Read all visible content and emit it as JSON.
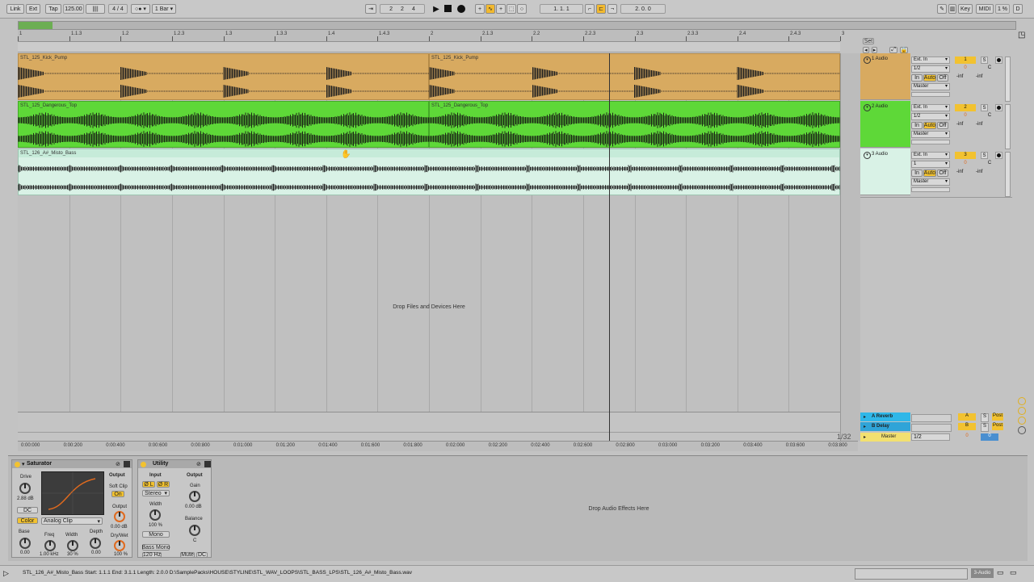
{
  "toolbar": {
    "link": "Link",
    "ext": "Ext",
    "tap": "Tap",
    "tempo": "125.00",
    "sig_num": "4",
    "sig_slash": "/",
    "sig_den": "4",
    "quant": "1 Bar",
    "pos_bar": "2",
    "pos_beat": "2",
    "pos_six": "4",
    "loop_start": "1.  1.  1",
    "loop_len": "2.   0.   0",
    "key": "Key",
    "midi": "MIDI",
    "cpu": "1 %",
    "d": "D"
  },
  "ruler": {
    "set_label": "Set",
    "bars": [
      "1",
      "1.1.3",
      "1.2",
      "1.2.3",
      "1.3",
      "1.3.3",
      "1.4",
      "1.4.3",
      "2",
      "2.1.3",
      "2.2",
      "2.2.3",
      "2.3",
      "2.3.3",
      "2.4",
      "2.4.3",
      "3"
    ]
  },
  "tracks": [
    {
      "name": "1 Audio",
      "clip1": "STL_125_Kick_Pump",
      "clip2": "STL_125_Kick_Pump",
      "input": "Ext. In",
      "channel": "1/2",
      "monitor_in": "In",
      "monitor_auto": "Auto",
      "monitor_off": "Off",
      "output": "Master",
      "num": "1",
      "vol": "0",
      "pan": "C",
      "solo": "S",
      "vol_db": "-inf",
      "peak_db": "-inf",
      "color": "#d8aa60"
    },
    {
      "name": "2 Audio",
      "clip1": "STL_125_Dangerous_Top",
      "clip2": "STL_125_Dangerous_Top",
      "input": "Ext. In",
      "channel": "1/2",
      "monitor_in": "In",
      "monitor_auto": "Auto",
      "monitor_off": "Off",
      "output": "Master",
      "num": "2",
      "vol": "0",
      "pan": "C",
      "solo": "S",
      "vol_db": "-inf",
      "peak_db": "-inf",
      "color": "#5ed838"
    },
    {
      "name": "3 Audio",
      "clip1": "STL_126_A#_Misto_Bass",
      "input": "Ext. In",
      "channel": "1",
      "monitor_in": "In",
      "monitor_auto": "Auto",
      "monitor_off": "Off",
      "output": "Master",
      "num": "3",
      "vol": "0",
      "pan": "C",
      "solo": "S",
      "vol_db": "-inf",
      "peak_db": "-inf",
      "color": "#d9f2e6"
    }
  ],
  "drop_files": "Drop Files and Devices Here",
  "returns": [
    {
      "name": "A Reverb",
      "num": "A",
      "solo": "S",
      "post": "Post",
      "color": "#2fb7e8"
    },
    {
      "name": "B Delay",
      "num": "B",
      "solo": "S",
      "post": "Post",
      "color": "#2fa4d8"
    }
  ],
  "master": {
    "name": "Master",
    "channel": "1/2",
    "num": "0",
    "vol": "0"
  },
  "time_ruler": [
    "0:00:000",
    "0:00:200",
    "0:00:400",
    "0:00:600",
    "0:00:800",
    "0:01:000",
    "0:01:200",
    "0:01:400",
    "0:01:600",
    "0:01:800",
    "0:02:000",
    "0:02:200",
    "0:02:400",
    "0:02:600",
    "0:02:800",
    "0:03:000",
    "0:03:200",
    "0:03:400",
    "0:03:600",
    "0:03:800"
  ],
  "zoom_label": "1/32",
  "saturator": {
    "title": "Saturator",
    "drive": "Drive",
    "drive_val": "2.88 dB",
    "dc": "DC",
    "color": "Color",
    "type": "Analog Clip",
    "output_hdr": "Output",
    "soft_clip": "Soft Clip",
    "soft_on": "On",
    "output": "Output",
    "output_val": "0.00 dB",
    "base": "Base",
    "base_val": "0.00",
    "freq": "Freq",
    "freq_val": "1.00 kHz",
    "width": "Width",
    "width_val": "30 %",
    "depth": "Depth",
    "depth_val": "0.00",
    "drywet": "Dry/Wet",
    "drywet_val": "100 %"
  },
  "utility": {
    "title": "Utility",
    "input": "Input",
    "output": "Output",
    "phi_l": "Ø L",
    "phi_r": "Ø R",
    "stereo": "Stereo",
    "gain": "Gain",
    "gain_val": "0.00 dB",
    "width": "Width",
    "width_val": "100 %",
    "mono": "Mono",
    "balance": "Balance",
    "balance_val": "C",
    "bass_mono": "Bass Mono",
    "bass_freq": "120 Hz",
    "mute": "Mute",
    "dc": "DC"
  },
  "drop_effects": "Drop Audio Effects Here",
  "status_text": "STL_126_A#_Misto_Bass  Start: 1.1.1  End: 3.1.1  Length: 2.0.0  D:\\SamplePacks\\HOUSE\\STYLINE\\STL_WAV_LOOPS\\STL_BASS_LPS\\STL_126_A#_Misto_Bass.wav",
  "status_track": "3-Audio"
}
